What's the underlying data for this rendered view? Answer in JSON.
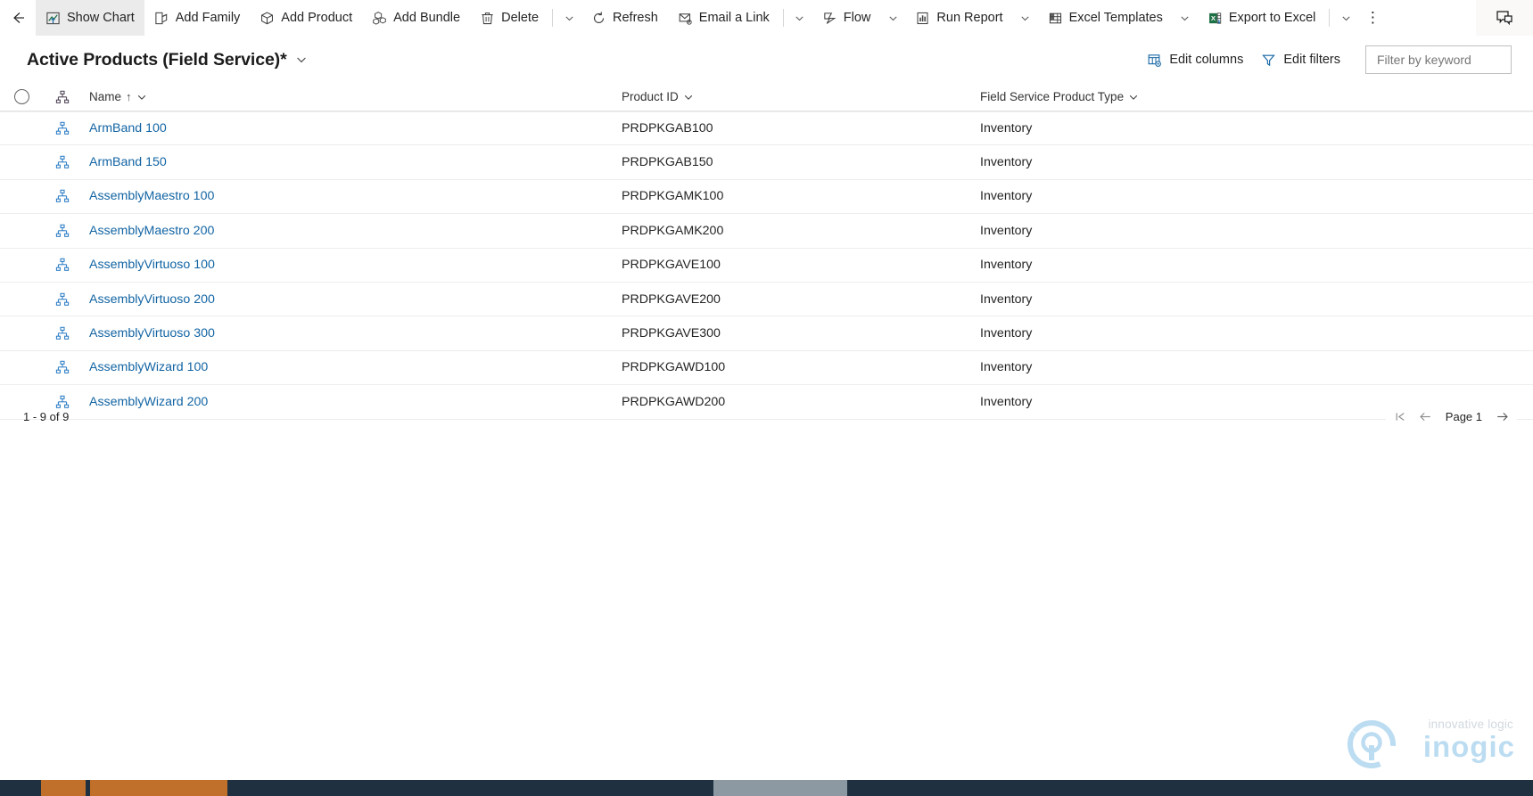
{
  "commandbar": {
    "back_icon": "arrow-left-icon",
    "buttons": [
      {
        "label": "Show Chart",
        "icon": "chart-icon",
        "active": true,
        "caret": false
      },
      {
        "label": "Add Family",
        "icon": "add-family-icon",
        "active": false,
        "caret": false
      },
      {
        "label": "Add Product",
        "icon": "add-product-icon",
        "active": false,
        "caret": false
      },
      {
        "label": "Add Bundle",
        "icon": "add-bundle-icon",
        "active": false,
        "caret": false
      },
      {
        "label": "Delete",
        "icon": "trash-icon",
        "active": false,
        "caret": true,
        "sep_before_caret": true
      },
      {
        "label": "Refresh",
        "icon": "refresh-icon",
        "active": false,
        "caret": false
      },
      {
        "label": "Email a Link",
        "icon": "email-link-icon",
        "active": false,
        "caret": true,
        "sep_before_caret": true
      },
      {
        "label": "Flow",
        "icon": "flow-icon",
        "active": false,
        "caret": true
      },
      {
        "label": "Run Report",
        "icon": "run-report-icon",
        "active": false,
        "caret": true
      },
      {
        "label": "Excel Templates",
        "icon": "excel-templates-icon",
        "active": false,
        "caret": true
      },
      {
        "label": "Export to Excel",
        "icon": "export-excel-icon",
        "active": false,
        "caret": true,
        "sep_before_caret": true
      }
    ],
    "overflow_label": "⋮",
    "overflow_name": "more-commands-button",
    "feedback_icon": "feedback-chat-icon"
  },
  "view": {
    "title": "Active Products (Field Service)*",
    "title_caret_icon": "chevron-down-icon",
    "edit_columns_label": "Edit columns",
    "edit_columns_icon": "edit-columns-icon",
    "edit_filters_label": "Edit filters",
    "edit_filters_icon": "filter-icon",
    "search_placeholder": "Filter by keyword",
    "search_value": ""
  },
  "grid": {
    "select_all_name": "select-all-circle",
    "row_icon": "hierarchy-icon",
    "columns": [
      {
        "label": "Name",
        "sorted": true,
        "sort_arrow": "↑",
        "caret_icon": "chevron-down-icon"
      },
      {
        "label": "Product ID",
        "sorted": false,
        "sort_arrow": "",
        "caret_icon": "chevron-down-icon"
      },
      {
        "label": "Field Service Product Type",
        "sorted": false,
        "sort_arrow": "",
        "caret_icon": "chevron-down-icon"
      }
    ],
    "rows": [
      {
        "name": "ArmBand 100",
        "product_id": "PRDPKGAB100",
        "product_type": "Inventory"
      },
      {
        "name": "ArmBand 150",
        "product_id": "PRDPKGAB150",
        "product_type": "Inventory"
      },
      {
        "name": "AssemblyMaestro 100",
        "product_id": "PRDPKGAMK100",
        "product_type": "Inventory"
      },
      {
        "name": "AssemblyMaestro 200",
        "product_id": "PRDPKGAMK200",
        "product_type": "Inventory"
      },
      {
        "name": "AssemblyVirtuoso 100",
        "product_id": "PRDPKGAVE100",
        "product_type": "Inventory"
      },
      {
        "name": "AssemblyVirtuoso 200",
        "product_id": "PRDPKGAVE200",
        "product_type": "Inventory"
      },
      {
        "name": "AssemblyVirtuoso 300",
        "product_id": "PRDPKGAVE300",
        "product_type": "Inventory"
      },
      {
        "name": "AssemblyWizard 100",
        "product_id": "PRDPKGAWD100",
        "product_type": "Inventory"
      },
      {
        "name": "AssemblyWizard 200",
        "product_id": "PRDPKGAWD200",
        "product_type": "Inventory"
      }
    ]
  },
  "footer": {
    "row_count": "1 - 9 of 9",
    "first_page_icon": "first-page-icon",
    "prev_page_icon": "previous-page-icon",
    "page_label": "Page 1",
    "next_page_icon": "next-page-icon"
  },
  "watermark": {
    "tagline": "innovative logic",
    "wordmark": "inogic",
    "logo_icon": "inogic-logo-icon"
  },
  "colors": {
    "link": "#1264a3",
    "accent_excel_green": "#1d7044",
    "taskbar": "#1f3141",
    "taskbar_accent": "#c0702a",
    "text": "#242424"
  }
}
